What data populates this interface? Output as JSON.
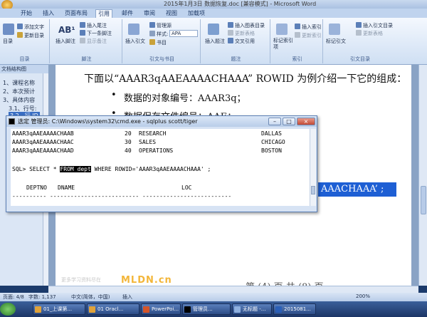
{
  "window": {
    "title": "2015年1月3日 数据恢复.doc [兼容模式] - Microsoft Word"
  },
  "tabs": [
    "开始",
    "插入",
    "页面布局",
    "引用",
    "邮件",
    "审阅",
    "视图",
    "加载项"
  ],
  "active_tab_index": 3,
  "ribbon": {
    "toc": {
      "big": "目录",
      "add_text": "添加文字",
      "update": "更新目录",
      "label": "目录"
    },
    "footnote": {
      "insert": "插入脚注",
      "insert_endnote": "插入尾注",
      "next": "下一条脚注",
      "show": "显示备注",
      "label": "脚注"
    },
    "citation": {
      "insert": "插入引文",
      "manage": "管理源",
      "style_label": "样式:",
      "style_value": "APA",
      "biblio": "书目",
      "label": "引文与书目"
    },
    "caption": {
      "insert": "插入题注",
      "insert_table": "插入图表目录",
      "update_table": "更新表格",
      "cross": "交叉引用",
      "label": "题注"
    },
    "index": {
      "mark": "标记索引项",
      "insert": "插入索引",
      "update": "更新索引",
      "label": "索引"
    },
    "toa": {
      "mark": "标记引文",
      "insert": "插入引文目录",
      "update": "更新表格",
      "label": "引文目录"
    }
  },
  "nav": {
    "header": "文档结构图",
    "items": [
      "1、课程名称",
      "2、本次预计",
      "3、具体内容",
      "3.1、行号:",
      "3.2、行 ID"
    ],
    "selected_index": 4
  },
  "doc": {
    "line1": "下面以“AAAR3qAAEAAAACHAAA” ROWID 为例介绍一下它的组成：",
    "bullet1": "数据的对象编号：AAAR3q；",
    "bullet2": "数据保存文件编号：AAE；",
    "highlight": "AAACHAAA’ ;",
    "page_indicator": "第 (4) 页   共 (8) 页",
    "watermark": "MLDN.cn",
    "watermark_sub": "更多学习资料尽在"
  },
  "cmd": {
    "title": "选定 管理员: C:\\Windows\\system32\\cmd.exe - sqlplus  scott/tiger",
    "rows": [
      {
        "rowid": "AAAR3qAAEAAAACHAAB",
        "deptno": "20",
        "dname": "RESEARCH",
        "loc": "DALLAS"
      },
      {
        "rowid": "AAAR3qAAEAAAACHAAC",
        "deptno": "30",
        "dname": "SALES",
        "loc": "CHICAGO"
      },
      {
        "rowid": "AAAR3qAAEAAAACHAAD",
        "deptno": "40",
        "dname": "OPERATIONS",
        "loc": "BOSTON"
      }
    ],
    "sql_prompt": "SQL> SELECT * ",
    "sql_highlight": "FROM dept",
    "sql_rest": " WHERE ROWID='AAAR3qAAEAAAACHAAA' ;",
    "col_deptno": "DEPTNO",
    "col_dname": "DNAME",
    "col_loc": "LOC",
    "dashes": "---------- -------------------------- --------------------------"
  },
  "status": {
    "page": "页面: 4/8",
    "words": "字数: 1,137",
    "lang": "中文(简体，中国)",
    "mode": "插入",
    "zoom": "200%"
  },
  "taskbar": {
    "items": [
      "01_上课第...",
      "01 Oracl...",
      "PowerPoi...",
      "管理员...",
      "无标题 -...",
      "2015081..."
    ]
  },
  "colors": {
    "accent": "#1e5fd4",
    "ribbon": "#cfdff3",
    "taskbar": "#1c3566"
  }
}
